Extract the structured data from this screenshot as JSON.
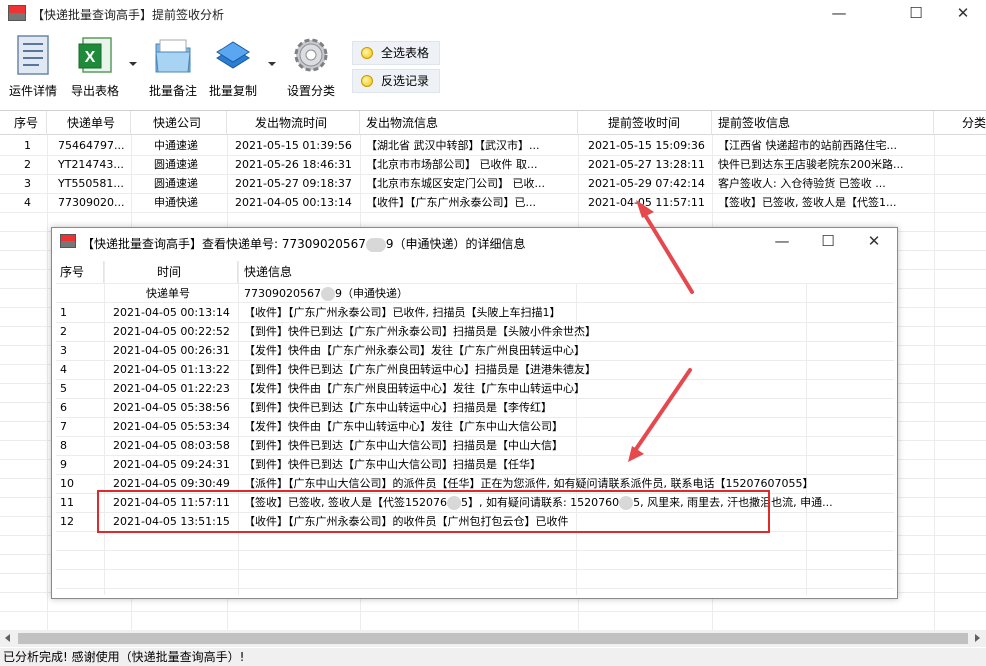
{
  "window": {
    "title": "【快递批量查询高手】提前签收分析",
    "minimize": "—",
    "maximize": "☐",
    "close": "✕"
  },
  "toolbar": {
    "buttons": [
      {
        "label": "运件详情",
        "icon": "document-icon"
      },
      {
        "label": "导出表格",
        "icon": "excel-icon"
      },
      {
        "label": "批量备注",
        "icon": "folder-icon"
      },
      {
        "label": "批量复制",
        "icon": "copy-icon"
      },
      {
        "label": "设置分类",
        "icon": "gear-icon"
      }
    ],
    "select_all": "全选表格",
    "invert_select": "反选记录"
  },
  "main_table": {
    "columns": [
      "序号",
      "快递单号",
      "快递公司",
      "发出物流时间",
      "发出物流信息",
      "提前签收时间",
      "提前签收信息",
      "分类"
    ],
    "rows": [
      [
        "1",
        "75464797...",
        "中通速递",
        "2021-05-15 01:39:56",
        "【湖北省 武汉中转部】【武汉市】...",
        "2021-05-15 15:09:36",
        "【江西省 快递超市的站前西路住宅..."
      ],
      [
        "2",
        "YT214743...",
        "圆通速递",
        "2021-05-26 18:46:31",
        "【北京市市场部公司】 已收件 取...",
        "2021-05-27 13:28:11",
        "快件已到达东王店骏老院东200米路..."
      ],
      [
        "3",
        "YT550581...",
        "圆通速递",
        "2021-05-27 09:18:37",
        "【北京市东城区安定门公司】 已收...",
        "2021-05-29 07:42:14",
        "客户签收人: 入仓待验货 已签收 ..."
      ],
      [
        "4",
        "77309020...",
        "申通快递",
        "2021-04-05 00:13:14",
        "【收件】【广东广州永泰公司】已...",
        "2021-04-05 11:57:11",
        "【签收】已签收, 签收人是【代签1..."
      ]
    ]
  },
  "status": "已分析完成! 感谢使用（快递批量查询高手）!",
  "dialog": {
    "title_prefix": "【快递批量查询高手】查看快递单号: 77309020567",
    "title_suffix": "9（申通快递）的详细信息",
    "columns": [
      "序号",
      "时间",
      "快递信息"
    ],
    "sub_header_label": "快递单号",
    "sub_header_value_prefix": "77309020567",
    "sub_header_value_suffix": "9（申通快递）",
    "rows": [
      [
        "1",
        "2021-04-05 00:13:14",
        "【收件】【广东广州永泰公司】已收件, 扫描员【头陂上车扫描1】"
      ],
      [
        "2",
        "2021-04-05 00:22:52",
        "【到件】快件已到达【广东广州永泰公司】扫描员是【头陂小件余世杰】"
      ],
      [
        "3",
        "2021-04-05 00:26:31",
        "【发件】快件由【广东广州永泰公司】发往【广东广州良田转运中心】"
      ],
      [
        "4",
        "2021-04-05 01:13:22",
        "【到件】快件已到达【广东广州良田转运中心】扫描员是【进港朱德友】"
      ],
      [
        "5",
        "2021-04-05 01:22:23",
        "【发件】快件由【广东广州良田转运中心】发往【广东中山转运中心】"
      ],
      [
        "6",
        "2021-04-05 05:38:56",
        "【到件】快件已到达【广东中山转运中心】扫描员是【李传红】"
      ],
      [
        "7",
        "2021-04-05 05:53:34",
        "【发件】快件由【广东中山转运中心】发往【广东中山大信公司】"
      ],
      [
        "8",
        "2021-04-05 08:03:58",
        "【到件】快件已到达【广东中山大信公司】扫描员是【中山大信】"
      ],
      [
        "9",
        "2021-04-05 09:24:31",
        "【到件】快件已到达【广东中山大信公司】扫描员是【任华】"
      ],
      [
        "10",
        "2021-04-05 09:30:49",
        "【派件】【广东中山大信公司】的派件员【任华】正在为您派件, 如有疑问请联系派件员, 联系电话【15207607055】"
      ],
      [
        "11",
        "2021-04-05 11:57:11",
        "【签收】已签收, 签收人是【代签152076",
        "5】, 如有疑问请联系: 1520760",
        "5, 风里来, 雨里去, 汗也撒泪也流, 申通..."
      ],
      [
        "12",
        "2021-04-05 13:51:15",
        "【收件】【广东广州永泰公司】的收件员【广州包打包云仓】已收件"
      ]
    ]
  },
  "colors": {
    "highlight": "#e02a2a",
    "arrow": "#e5484d"
  }
}
